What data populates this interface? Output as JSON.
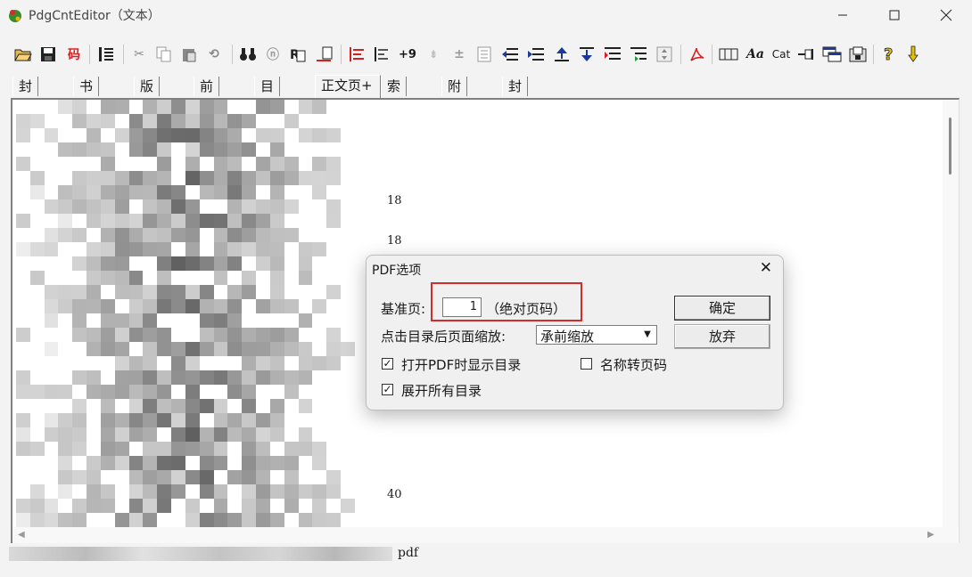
{
  "window": {
    "title": "PdgCntEditor（文本）",
    "controls": [
      "minimize",
      "maximize",
      "close"
    ]
  },
  "toolbar": {
    "code_button_text": "码",
    "cat_text": "Cat",
    "aa_text": "Aa",
    "icons": [
      "open-folder",
      "save",
      "code",
      "outline",
      "cut",
      "copy",
      "paste",
      "undo",
      "find",
      "find-next",
      "replace",
      "replace-all",
      "align-left",
      "indent",
      "goto-page",
      "level-down",
      "level-up",
      "page",
      "move-left",
      "move-right",
      "move-up",
      "move-down",
      "insert-top",
      "insert-sub",
      "fit",
      "pdf",
      "columns",
      "font",
      "category",
      "pin",
      "window",
      "export",
      "help",
      "settings"
    ]
  },
  "tabs": [
    "封面页",
    "书名页",
    "版权页",
    "前言页",
    "目录页",
    "正文页+",
    "索引页",
    "附录页",
    "封底页"
  ],
  "active_tab": "正文页+",
  "content": {
    "page_numbers": [
      "18",
      "18",
      "40"
    ]
  },
  "statusbar": {
    "text": "pdf"
  },
  "dialog": {
    "title": "PDF选项",
    "base_page_label": "基准页:",
    "base_page_value": "1",
    "base_page_note": "（绝对页码）",
    "zoom_label": "点击目录后页面缩放:",
    "zoom_value": "承前缩放",
    "ok_label": "确定",
    "cancel_label": "放弃",
    "show_toc_label": "打开PDF时显示目录",
    "show_toc_checked": true,
    "name_to_page_label": "名称转页码",
    "name_to_page_checked": false,
    "expand_all_label": "展开所有目录",
    "expand_all_checked": true,
    "highlight_color": "#d22c2c"
  }
}
